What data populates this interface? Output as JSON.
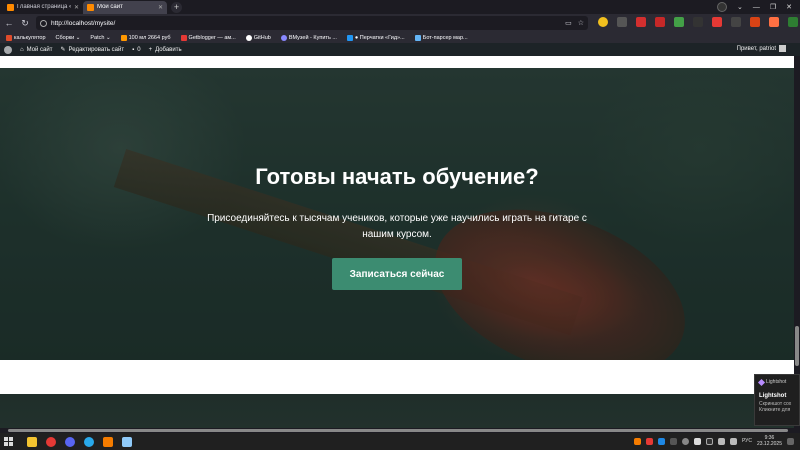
{
  "browser": {
    "tabs": [
      {
        "label": "Главная страница «Шаб",
        "active": false
      },
      {
        "label": "Мой сайт",
        "active": true
      }
    ],
    "new_tab": "+",
    "url": "http://localhost/mysite/",
    "nav": {
      "back": "←",
      "forward": "→",
      "reload": "↻"
    },
    "url_buttons": {
      "shield": "⚙",
      "star": "☆"
    }
  },
  "bookmarks": [
    {
      "label": "калькулятор",
      "color": "#e04b2b"
    },
    {
      "label": "Сборки ⌄",
      "color": "#444444"
    },
    {
      "label": "Patch ⌄",
      "color": "#444444"
    },
    {
      "label": "100 мл 2664 руб",
      "color": "#ff9800"
    },
    {
      "label": "Getblogger — ам...",
      "color": "#e53935"
    },
    {
      "label": "GitHub",
      "color": "#ffffff"
    },
    {
      "label": "ВМузей - Купить ...",
      "color": "#8888ff"
    },
    {
      "label": "● Перчатки «Гид»...",
      "color": "#2196f3"
    },
    {
      "label": "Бот-парсер мар...",
      "color": "#64b5f6"
    }
  ],
  "wp_admin": {
    "site": "Мой сайт",
    "customize": "Редактировать сайт",
    "comments": "0",
    "add_new": "Добавить",
    "greeting": "Привет, patriot"
  },
  "hero": {
    "title": "Готовы начать обучение?",
    "subtitle": "Присоединяйтесь к тысячам учеников, которые уже научились играть на гитаре с нашим курсом.",
    "cta": "Записаться сейчас"
  },
  "notification": {
    "app": "Lightshot",
    "title": "Lightshot",
    "line1": "Скриншот сох",
    "line2": "Кликните для"
  },
  "taskbar": {
    "lang": "РУС",
    "time": "9:36",
    "date": "23.12.2025"
  },
  "colors": {
    "accent": "#3c8c71",
    "admin_bar": "#1d2327"
  }
}
